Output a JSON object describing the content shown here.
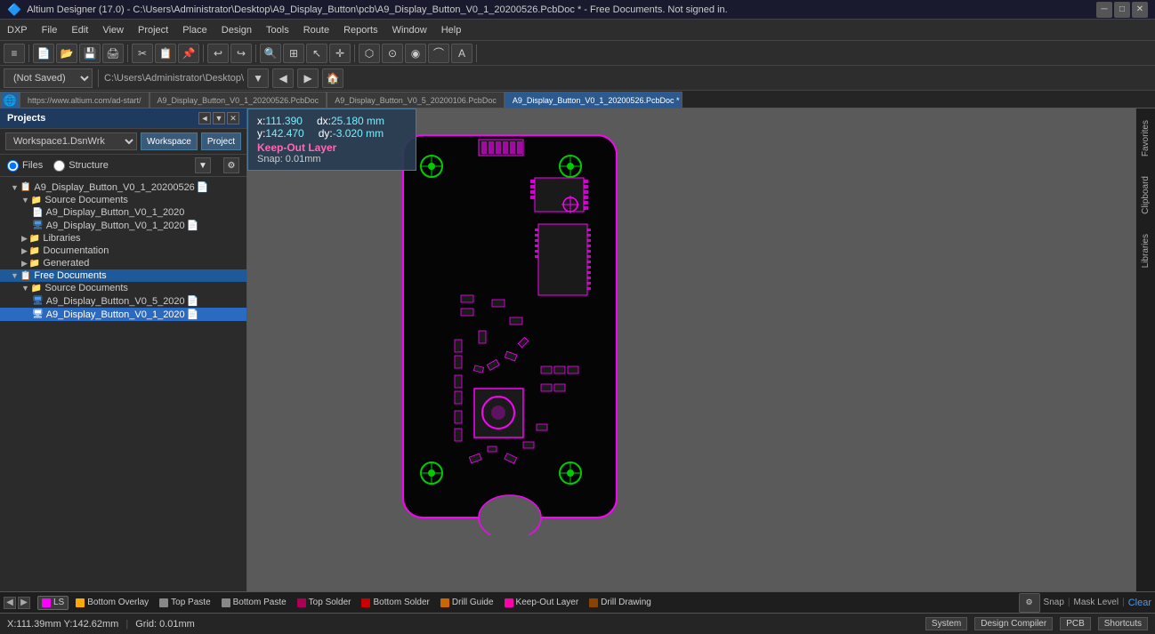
{
  "titlebar": {
    "icon": "🔷",
    "title": "Altium Designer (17.0) - C:\\Users\\Administrator\\Desktop\\A9_Display_Button\\pcb\\A9_Display_Button_V0_1_20200526.PcbDoc * - Free Documents. Not signed in.",
    "minimize": "─",
    "maximize": "□",
    "close": "✕"
  },
  "menubar": {
    "items": [
      "DXP",
      "File",
      "Edit",
      "View",
      "Project",
      "Place",
      "Design",
      "Tools",
      "Route",
      "Reports",
      "Window",
      "Help"
    ]
  },
  "toolbar1": {
    "buttons": [
      "≡",
      "📂",
      "💾",
      "🖨",
      "✂",
      "📋",
      "↩",
      "↪",
      "🔍"
    ]
  },
  "toolbar2": {
    "not_saved": "(Not Saved)",
    "path": "C:\\Users\\Administrator\\Desktop\\"
  },
  "tabs": {
    "home": "🏠",
    "items": [
      {
        "label": "https://www.altium.com/ad-start/",
        "active": false
      },
      {
        "label": "A9_Display_Button_V0_1_20200526.PcbDoc",
        "active": false
      },
      {
        "label": "A9_Display_Button_V0_5_20200106.PcbDoc",
        "active": false
      },
      {
        "label": "A9_Display_Button_V0_1_20200526.PcbDoc *",
        "active": true
      }
    ]
  },
  "left_panel": {
    "title": "Projects",
    "pin_btn": "📌",
    "close_btn": "✕",
    "workspace_label": "Workspace1.DsnWrk",
    "workspace_btn": "Workspace",
    "project_btn": "Project",
    "radio_files": "Files",
    "radio_structure": "Structure",
    "tree": [
      {
        "level": 1,
        "type": "project",
        "label": "A9_Display_Button_V0_1_20200526",
        "expanded": true,
        "icon": "📋"
      },
      {
        "level": 2,
        "type": "folder",
        "label": "Source Documents",
        "expanded": true,
        "icon": "📁"
      },
      {
        "level": 3,
        "type": "doc",
        "label": "A9_Display_Button_V0_1_2020",
        "icon": "📄"
      },
      {
        "level": 3,
        "type": "pcb",
        "label": "A9_Display_Button_V0_1_2020",
        "icon": "🖥"
      },
      {
        "level": 2,
        "type": "folder",
        "label": "Libraries",
        "expanded": false,
        "icon": "📁"
      },
      {
        "level": 2,
        "type": "folder",
        "label": "Documentation",
        "expanded": false,
        "icon": "📁"
      },
      {
        "level": 2,
        "type": "folder",
        "label": "Generated",
        "expanded": false,
        "icon": "📁"
      },
      {
        "level": 1,
        "type": "project",
        "label": "Free Documents",
        "expanded": true,
        "icon": "📋",
        "selected": true
      },
      {
        "level": 2,
        "type": "folder",
        "label": "Source Documents",
        "expanded": true,
        "icon": "📁"
      },
      {
        "level": 3,
        "type": "pcb",
        "label": "A9_Display_Button_V0_5_2020",
        "icon": "🖥"
      },
      {
        "level": 3,
        "type": "pcb",
        "label": "A9_Display_Button_V0_1_2020",
        "icon": "🖥",
        "selected": true
      }
    ]
  },
  "coord_tooltip": {
    "x_label": "x:",
    "x_val": "111.390",
    "dx_label": "dx:",
    "dx_val": "25.180 mm",
    "y_label": "y:",
    "y_val": "142.470",
    "dy_label": "dy:",
    "dy_val": "-3.020  mm",
    "layer": "Keep-Out Layer",
    "snap": "Snap: 0.01mm"
  },
  "right_panel": {
    "tabs": [
      "Favorites",
      "Clipboard",
      "Libraries"
    ]
  },
  "layerbar": {
    "nav_left": "◀",
    "nav_right": "▶",
    "layers": [
      {
        "label": "LS",
        "color": "#ff00ff",
        "active": true
      },
      {
        "label": "Bottom Overlay",
        "color": "#ffaa00"
      },
      {
        "label": "Top Paste",
        "color": "#888888"
      },
      {
        "label": "Bottom Paste",
        "color": "#888888"
      },
      {
        "label": "Top Solder",
        "color": "#aa0055"
      },
      {
        "label": "Bottom Solder",
        "color": "#cc0000"
      },
      {
        "label": "Drill Guide",
        "color": "#cc6600"
      },
      {
        "label": "Keep-Out Layer",
        "color": "#ff00aa"
      },
      {
        "label": "Drill Drawing",
        "color": "#884400"
      }
    ],
    "clear": "Clear"
  },
  "statusbar": {
    "coords": "X:111.39mm Y:142.62mm",
    "grid": "Grid: 0.01mm",
    "snap_label": "Snap",
    "mask_level": "Mask Level",
    "system": "System",
    "design_compiler": "Design Compiler",
    "pcb": "PCB",
    "shortcuts": "Shortcuts"
  }
}
